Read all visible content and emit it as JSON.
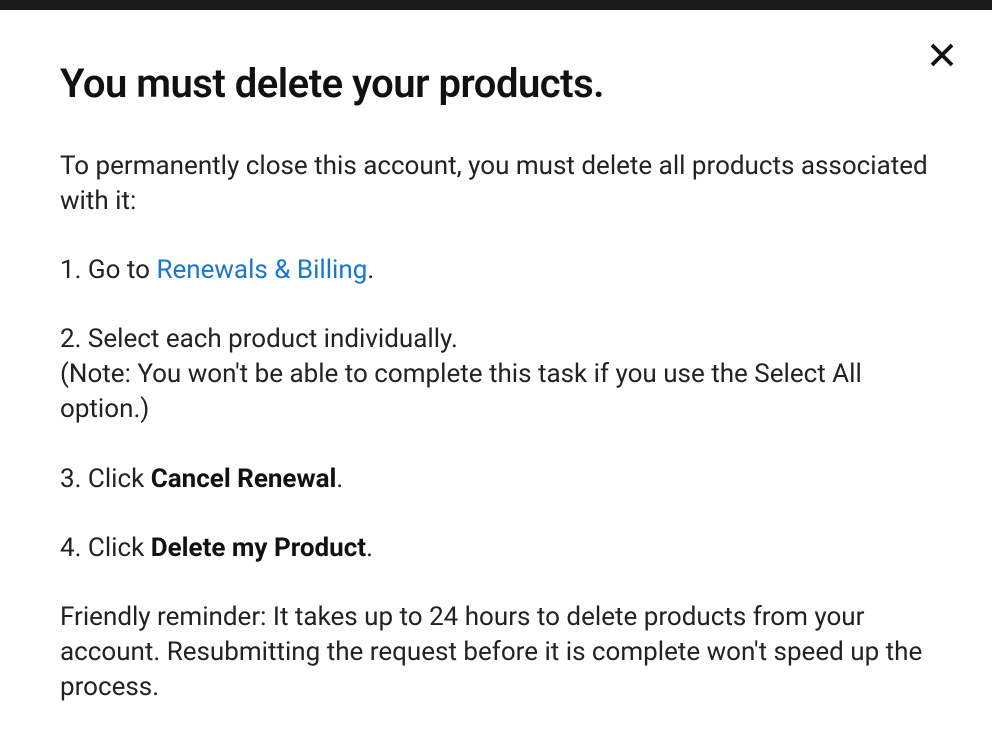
{
  "modal": {
    "title": "You must delete your products.",
    "intro": "To permanently close this account, you must delete all products associated with it:",
    "step1": {
      "prefix": "1. Go to ",
      "link": "Renewals & Billing",
      "suffix": "."
    },
    "step2": {
      "line1": "2. Select each product individually.",
      "line2": "(Note: You won't be able to complete this task if you use the Select All option.)"
    },
    "step3": {
      "prefix": "3. Click ",
      "bold": "Cancel Renewal",
      "suffix": "."
    },
    "step4": {
      "prefix": "4. Click ",
      "bold": "Delete my Product",
      "suffix": "."
    },
    "reminder": "Friendly reminder: It takes up to 24 hours to delete products from your account. Resubmitting the request before it is complete won't speed up the process."
  }
}
